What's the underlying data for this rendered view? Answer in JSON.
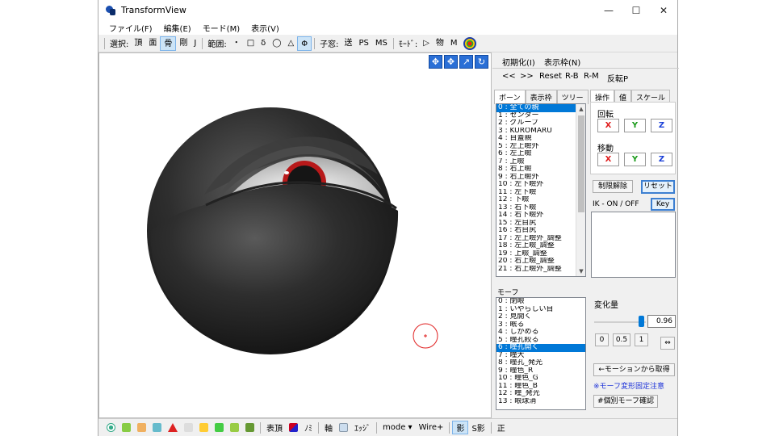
{
  "window": {
    "title": "TransformView",
    "controls": [
      "—",
      "☐",
      "✕"
    ]
  },
  "menu": [
    "ファイル(F)",
    "編集(E)",
    "モード(M)",
    "表示(V)"
  ],
  "toolbar": {
    "select_label": "選択:",
    "select_items": [
      "頂",
      "面",
      "骨",
      "剛",
      "J"
    ],
    "range_label": "範囲:",
    "range_items": [
      "・",
      "□",
      "δ",
      "◯",
      "△",
      "Φ"
    ],
    "child_label": "子窓:",
    "child_items": [
      "送",
      "PS",
      "MS"
    ],
    "mode_label": "ﾓｰﾄﾞ:",
    "mode_items": [
      "▷",
      "物",
      "M"
    ]
  },
  "viewport_tools": [
    "✥",
    "✥",
    "↗",
    "↻"
  ],
  "right_panel": {
    "init_btn": "初期化(I)",
    "display_frame_btn": "表示枠(N)",
    "nav": [
      "<<",
      ">>",
      "Reset",
      "R-B",
      "R-M",
      "反転P"
    ],
    "bone_tabs": [
      "ボーン",
      "表示枠",
      "ツリー"
    ],
    "bone_list": [
      "0 : 全ての親",
      "1 : センター",
      "2 : グループ",
      "3 : KUROMARU",
      "4 : 目蓋親",
      "5 : 左上瞼外",
      "6 : 左上瞼",
      "7 : 上瞼",
      "8 : 右上瞼",
      "9 : 右上瞼外",
      "10 : 左下瞼外",
      "11 : 左下瞼",
      "12 : 下瞼",
      "13 : 右下瞼",
      "14 : 右下瞼外",
      "15 : 左目尻",
      "16 : 右目尻",
      "17 : 左上瞼外_調整",
      "18 : 左上瞼_調整",
      "19 : 上瞼_調整",
      "20 : 右上瞼_調整",
      "21 : 右上瞼外_調整"
    ],
    "bone_selected": 0,
    "op_tabs": [
      "操作",
      "値",
      "スケール"
    ],
    "rotate_label": "回転",
    "move_label": "移動",
    "axes": [
      "X",
      "Y",
      "Z"
    ],
    "axis_colors": [
      "#e02020",
      "#1a9a1a",
      "#1a40d8"
    ],
    "limit_btn": "制限解除",
    "reset_btn": "リセット",
    "ik_label": "IK - ON / OFF",
    "key_btn": "Key",
    "morph_label": "モーフ",
    "morph_list": [
      "0 : 閉眼",
      "1 : いやらしい目",
      "2 : 見開く",
      "3 : 眠る",
      "4 : しかめる",
      "5 : 瞳孔絞る",
      "6 : 瞳孔開く",
      "7 : 瞳大",
      "8 : 瞳孔_発光",
      "9 : 瞳色_R",
      "10 : 瞳色_G",
      "11 : 瞳色_B",
      "12 : 瞳_発光",
      "13 : 眼球消"
    ],
    "morph_selected": 6,
    "amount_label": "変化量",
    "amount_value": "0.96",
    "slider_fraction": 0.96,
    "preset_btns": [
      "0",
      "0.5",
      "1"
    ],
    "motion_btn": "←モーションから取得",
    "note": "※モーフ変形固定注意",
    "confirm_btn": "#個別モーフ確認"
  },
  "statusbar": {
    "items": [
      "表頂",
      "ﾉﾐ",
      "軸",
      "ｴｯｼﾞ",
      "mode ▾",
      "Wire+",
      "影",
      "S影",
      "正"
    ]
  }
}
